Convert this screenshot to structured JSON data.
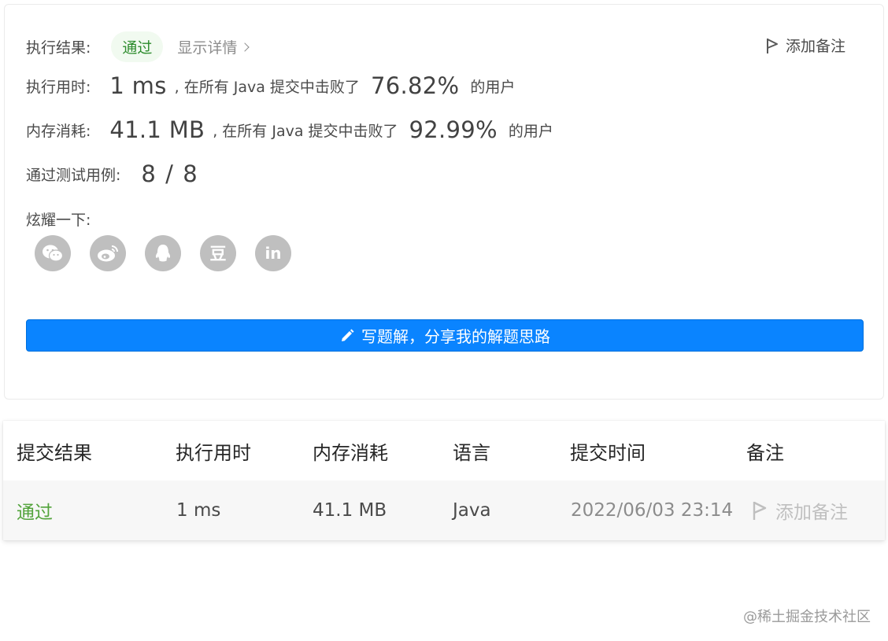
{
  "result": {
    "label": "执行结果:",
    "status": "通过",
    "details_link": "显示详情",
    "add_note": "添加备注"
  },
  "runtime": {
    "label": "执行用时:",
    "value": "1 ms",
    "text_before": ", 在所有 Java 提交中击败了",
    "percent": "76.82%",
    "text_after": "的用户"
  },
  "memory": {
    "label": "内存消耗:",
    "value": "41.1 MB",
    "text_before": ", 在所有 Java 提交中击败了",
    "percent": "92.99%",
    "text_after": "的用户"
  },
  "testcases": {
    "label": "通过测试用例:",
    "passed": "8",
    "separator": "/",
    "total": "8"
  },
  "share": {
    "label": "炫耀一下:",
    "icons": [
      "wechat-icon",
      "weibo-icon",
      "qq-icon",
      "douban-icon",
      "linkedin-icon"
    ],
    "douban_glyph": "豆",
    "linkedin_glyph": "in"
  },
  "write_solution": {
    "label": "写题解，分享我的解题思路"
  },
  "table": {
    "headers": [
      "提交结果",
      "执行用时",
      "内存消耗",
      "语言",
      "提交时间",
      "备注"
    ],
    "row": {
      "status": "通过",
      "runtime": "1 ms",
      "memory": "41.1 MB",
      "language": "Java",
      "time": "2022/06/03 23:14",
      "note": "添加备注"
    }
  },
  "colors": {
    "accent": "#0a84ff",
    "pass_green": "#52a33b",
    "icon_gray": "#bfbfbf"
  },
  "watermark": "@稀土掘金技术社区"
}
